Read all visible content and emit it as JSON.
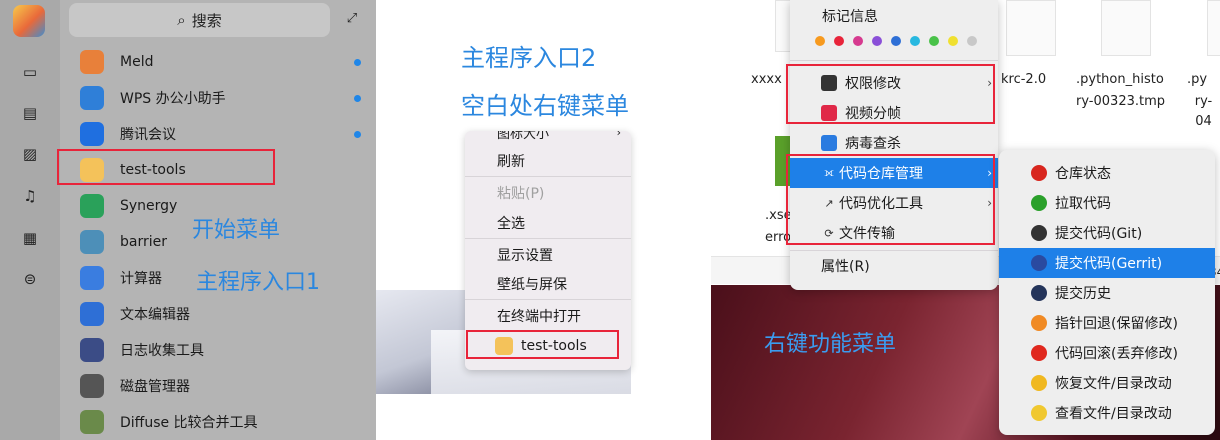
{
  "launcher": {
    "search_placeholder": "搜索",
    "apps": [
      {
        "label": "Meld",
        "icon": "meld-icon",
        "color": "#e8803a",
        "new": true
      },
      {
        "label": "WPS 办公小助手",
        "icon": "wps-assistant-icon",
        "color": "#2f7fd8",
        "new": true
      },
      {
        "label": "腾讯会议",
        "icon": "tencent-meeting-icon",
        "color": "#1f6fe0",
        "new": true
      },
      {
        "label": "test-tools",
        "icon": "test-tools-icon",
        "color": "#f4c25a",
        "new": false
      },
      {
        "label": "Synergy",
        "icon": "synergy-icon",
        "color": "#2aa15a",
        "new": false
      },
      {
        "label": "barrier",
        "icon": "barrier-icon",
        "color": "#4d8fb8",
        "new": false
      },
      {
        "label": "计算器",
        "icon": "calculator-icon",
        "color": "#3a7de0",
        "new": false
      },
      {
        "label": "文本编辑器",
        "icon": "text-editor-icon",
        "color": "#2e6fd6",
        "new": false
      },
      {
        "label": "日志收集工具",
        "icon": "log-collector-icon",
        "color": "#3b4c86",
        "new": false
      },
      {
        "label": "磁盘管理器",
        "icon": "disk-manager-icon",
        "color": "#555555",
        "new": false
      },
      {
        "label": "Diffuse 比较合并工具",
        "icon": "diffuse-icon",
        "color": "#6a8a4a",
        "new": false
      }
    ],
    "notes": {
      "start_menu": "开始菜单",
      "entry1": "主程序入口1"
    }
  },
  "desktop": {
    "notes": {
      "entry2": "主程序入口2",
      "blank_right_click": "空白处右键菜单"
    },
    "menu_cut_label": "图标大小",
    "menu": [
      {
        "label": "刷新",
        "disabled": false
      },
      {
        "label": "粘贴(P)",
        "disabled": true
      },
      {
        "label": "全选",
        "disabled": false
      },
      {
        "label": "显示设置",
        "disabled": false
      },
      {
        "label": "壁纸与屏保",
        "disabled": false
      },
      {
        "label": "在终端中打开",
        "disabled": false
      },
      {
        "label": "test-tools",
        "disabled": false
      }
    ]
  },
  "file_manager": {
    "files": [
      {
        "name": "xxxx"
      },
      {
        "name": "krc-2.0"
      },
      {
        "name": ".python_history-00323.tmp",
        "line1": ".python_histo",
        "line2": "ry-00323.tmp"
      },
      {
        "name": ".py",
        "line1": ".py",
        "line2": "ry-04"
      }
    ],
    "left_file": {
      "line1": ".xse",
      "line2": "erro"
    },
    "right_edge": "345",
    "tag_title": "标记信息",
    "tag_colors": [
      "#f79a1e",
      "#e8243a",
      "#d63a8f",
      "#8a4fd8",
      "#2e6fd6",
      "#28b8e0",
      "#49c249",
      "#f0e030",
      "#c8c8c8"
    ],
    "menu": [
      {
        "label": "权限修改",
        "icon": "permission-icon",
        "submenu": true
      },
      {
        "label": "视频分帧",
        "icon": "video-frame-icon",
        "submenu": false
      },
      {
        "label": "病毒查杀",
        "icon": "antivirus-icon",
        "submenu": false
      },
      {
        "label": "代码仓库管理",
        "icon": "code-repo-icon",
        "submenu": true,
        "active": true
      },
      {
        "label": "代码优化工具",
        "icon": "code-optimize-icon",
        "submenu": true
      },
      {
        "label": "文件传输",
        "icon": "file-transfer-icon",
        "submenu": false
      },
      {
        "label": "属性(R)",
        "icon": "",
        "submenu": false
      }
    ],
    "submenu": [
      {
        "label": "仓库状态",
        "icon": "repo-status-icon",
        "color": "#d8261e"
      },
      {
        "label": "拉取代码",
        "icon": "pull-code-icon",
        "color": "#2aa02a"
      },
      {
        "label": "提交代码(Git)",
        "icon": "git-commit-icon",
        "color": "#333333"
      },
      {
        "label": "提交代码(Gerrit)",
        "icon": "gerrit-commit-icon",
        "color": "#2a4aa0",
        "active": true
      },
      {
        "label": "提交历史",
        "icon": "commit-history-icon",
        "color": "#24345a"
      },
      {
        "label": "指针回退(保留修改)",
        "icon": "soft-reset-icon",
        "color": "#f08a24"
      },
      {
        "label": "代码回滚(丢弃修改)",
        "icon": "hard-reset-icon",
        "color": "#e0281e"
      },
      {
        "label": "恢复文件/目录改动",
        "icon": "restore-icon",
        "color": "#f0b820"
      },
      {
        "label": "查看文件/目录改动",
        "icon": "view-changes-icon",
        "color": "#f0c830"
      }
    ],
    "note": "右键功能菜单"
  }
}
